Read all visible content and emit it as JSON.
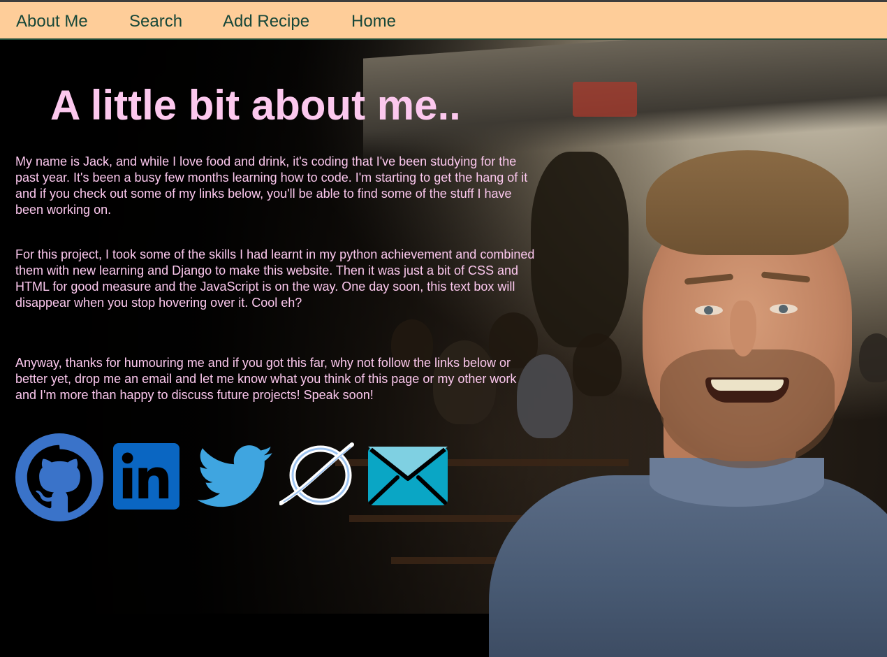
{
  "nav": {
    "items": [
      {
        "label": "About Me"
      },
      {
        "label": "Search"
      },
      {
        "label": "Add Recipe"
      },
      {
        "label": "Home"
      }
    ]
  },
  "main": {
    "heading": "A little bit about me..",
    "paragraphs": [
      "My name is Jack, and while I love food and drink, it's coding that I've been studying for the past year. It's been a busy few months learning how to code. I'm starting to get the hang of it and if you check out some of my links below, you'll be able to find some of the stuff I have been working on.",
      "For this project, I took some of the skills I had learnt in my python achievement and combined them with new learning and Django to make this website. Then it was just a bit of CSS and HTML for good measure and the JavaScript is on the way. One day soon, this text box will disappear when you stop hovering over it. Cool eh?",
      "Anyway, thanks for humouring me and if you got this far, why not follow the links below or better yet, drop me an email and let me know what you think of this page or my other work and I'm more than happy to discuss future projects! Speak soon!"
    ]
  },
  "social_links": [
    {
      "icon": "github-icon",
      "color": "#3a73c9"
    },
    {
      "icon": "linkedin-icon",
      "color": "#0a66c2"
    },
    {
      "icon": "twitter-icon",
      "color": "#3fa5e0"
    },
    {
      "icon": "portfolio-logo-icon",
      "color": "#cfe4ff"
    },
    {
      "icon": "email-icon",
      "color": "#0aa6c5"
    }
  ],
  "colors": {
    "nav_background": "#fecd99",
    "nav_text": "#174739",
    "text_pink": "#fcc8ee",
    "page_background": "#000000"
  }
}
